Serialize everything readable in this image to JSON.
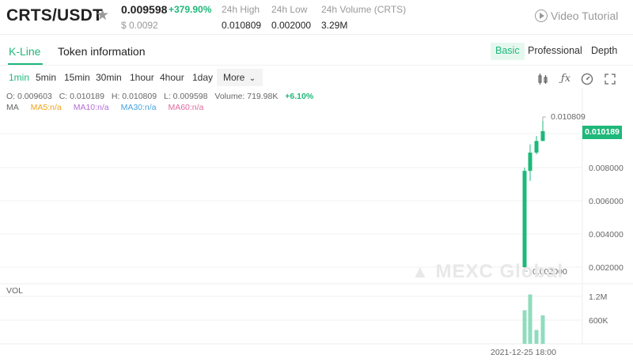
{
  "header": {
    "pair": "CRTS/USDT",
    "price": "0.009598",
    "change": "+379.90%",
    "usd_price": "$ 0.0092",
    "stats": [
      {
        "label": "24h High",
        "value": "0.010809"
      },
      {
        "label": "24h Low",
        "value": "0.002000"
      },
      {
        "label": "24h Volume (CRTS)",
        "value": "3.29M"
      }
    ],
    "video_tutorial": "Video Tutorial"
  },
  "tabs": {
    "kline": "K-Line",
    "token_info": "Token information",
    "views": [
      "Basic",
      "Professional",
      "Depth"
    ]
  },
  "intervals": {
    "items": [
      "1min",
      "5min",
      "15min",
      "30min",
      "1hour",
      "4hour",
      "1day"
    ],
    "more": "More"
  },
  "ohlc": {
    "open": "O: 0.009603",
    "close": "C: 0.010189",
    "high": "H: 0.010809",
    "low": "L: 0.009598",
    "volume": "Volume: 719.98K",
    "change": "+6.10%"
  },
  "ma": {
    "label": "MA",
    "ma5": "MA5:n/a",
    "ma10": "MA10:n/a",
    "ma30": "MA30:n/a",
    "ma60": "MA60:n/a",
    "colors": {
      "ma5": "#f0a31e",
      "ma10": "#b56ed6",
      "ma30": "#4aa4e0",
      "ma60": "#e06a9f"
    }
  },
  "chart": {
    "last_price": "0.010189",
    "high_marker": "0.010809",
    "low_marker": "0.002000",
    "vol_label": "VOL",
    "time_label": "2021-12-25 18:00",
    "watermark": "MEXC Global",
    "accent": "#1eb87a"
  },
  "chart_data": {
    "type": "candlestick",
    "y_ticks": [
      "0.008000",
      "0.006000",
      "0.004000",
      "0.002000"
    ],
    "vol_ticks": [
      "1.2M",
      "600K"
    ],
    "candles": [
      {
        "open": 0.002,
        "close": 0.0078,
        "high": 0.008,
        "low": 0.002
      },
      {
        "open": 0.0078,
        "close": 0.0089,
        "high": 0.0094,
        "low": 0.0072
      },
      {
        "open": 0.0089,
        "close": 0.0096,
        "high": 0.0099,
        "low": 0.0088
      },
      {
        "open": 0.0096,
        "close": 0.01019,
        "high": 0.01081,
        "low": 0.0096
      }
    ],
    "volumes": [
      850000,
      1250000,
      350000,
      720000
    ]
  }
}
